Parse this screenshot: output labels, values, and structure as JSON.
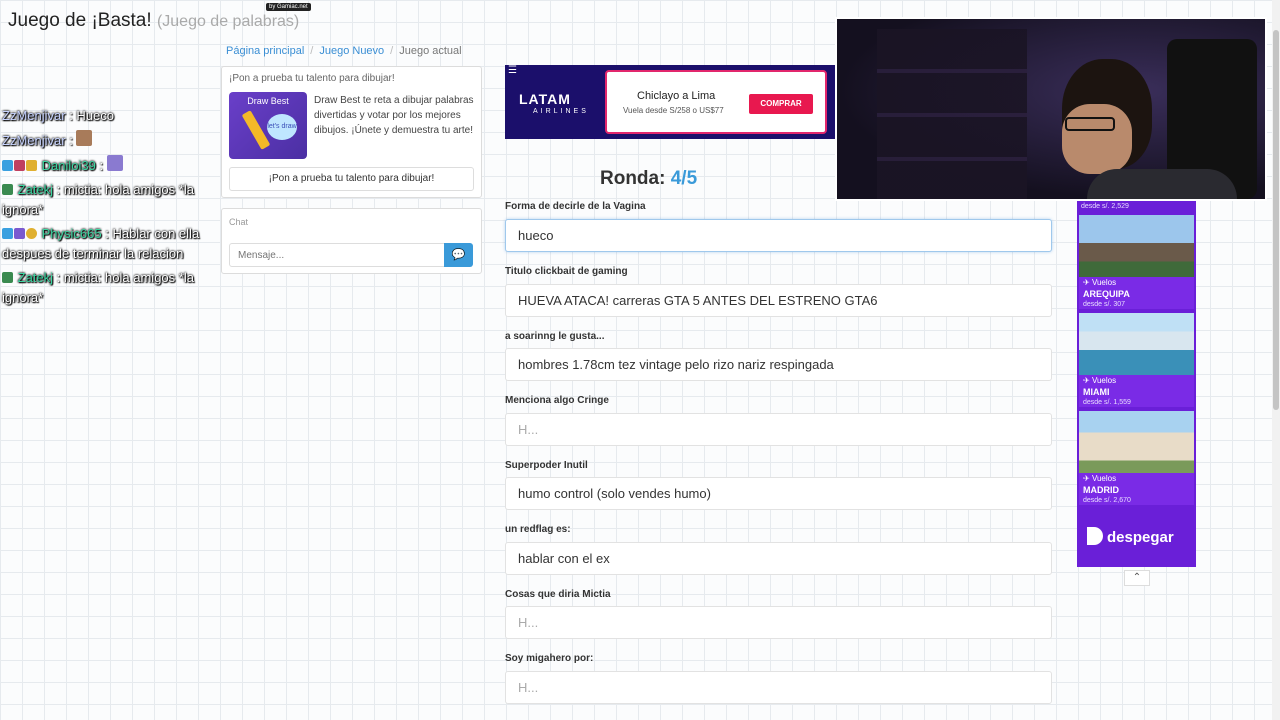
{
  "header": {
    "byline": "by Gamiac.net",
    "title": "Juego de ¡Basta!",
    "subtitle": "(Juego de palabras)"
  },
  "breadcrumb": [
    "Página principal",
    "Juego Nuevo",
    "Juego actual"
  ],
  "promo": {
    "heading": "¡Pon a prueba tu talento para dibujar!",
    "image_title": "Draw Best",
    "image_bubble": "let's draw",
    "text": "Draw Best te reta a dibujar palabras divertidas y votar por los mejores dibujos. ¡Únete y demuestra tu arte!",
    "button": "¡Pon a prueba tu talento para dibujar!"
  },
  "chat": {
    "label": "Chat",
    "placeholder": "Mensaje...",
    "send_icon": "chat-bubble-icon"
  },
  "stream_chat": [
    {
      "user": "ZzMenjivar",
      "text": ": Hueco"
    },
    {
      "user": "ZzMenjivar",
      "text": ":"
    },
    {
      "user": "Daniloi39",
      "text": ":"
    },
    {
      "user": "Zatekj",
      "text": ": mictia: hola amigos *la ignora*"
    },
    {
      "user": "Physic665",
      "text": ": Hablar con ella despues de terminar la relacion"
    },
    {
      "user": "Zatekj",
      "text": ": mictia: hola amigos *la ignora*"
    }
  ],
  "ad_banner": {
    "brand": "LATAM",
    "brand_sub": "AIRLINES",
    "route": "Chiclayo a Lima",
    "price": "Vuela desde S/258 o US$77",
    "cta": "COMPRAR"
  },
  "round": {
    "label": "Ronda:",
    "value": "4/5"
  },
  "fields": [
    {
      "label": "Forma de decirle de la Vagina",
      "value": "hueco",
      "placeholder": "H...",
      "focused": true
    },
    {
      "label": "Titulo clickbait de gaming",
      "value": "HUEVA ATACA! carreras GTA 5 ANTES DEL ESTRENO GTA6",
      "placeholder": "H..."
    },
    {
      "label": "a soarinng le gusta...",
      "value": "hombres 1.78cm tez vintage pelo rizo nariz respingada",
      "placeholder": "H..."
    },
    {
      "label": "Menciona algo Cringe",
      "value": "",
      "placeholder": "H..."
    },
    {
      "label": "Superpoder Inutil",
      "value": "humo control (solo vendes humo)",
      "placeholder": "H..."
    },
    {
      "label": "un redflag es:",
      "value": "hablar con el ex",
      "placeholder": "H..."
    },
    {
      "label": "Cosas que diria Mictia",
      "value": "",
      "placeholder": "H..."
    },
    {
      "label": "Soy migahero por:",
      "value": "",
      "placeholder": "H..."
    }
  ],
  "side_ad": {
    "top_price": "desde s/. 2,529",
    "tiles": [
      {
        "tag": "Vuelos",
        "city": "AREQUIPA",
        "price": "desde s/. 307"
      },
      {
        "tag": "Vuelos",
        "city": "MIAMI",
        "price": "desde s/. 1,559"
      },
      {
        "tag": "Vuelos",
        "city": "MADRID",
        "price": "desde s/. 2,670"
      }
    ],
    "brand": "despegar"
  },
  "colors": {
    "accent": "#3a9ad9",
    "ad_purple": "#6a1fd8",
    "latam_navy": "#1b0f6b",
    "latam_red": "#e8184f"
  }
}
